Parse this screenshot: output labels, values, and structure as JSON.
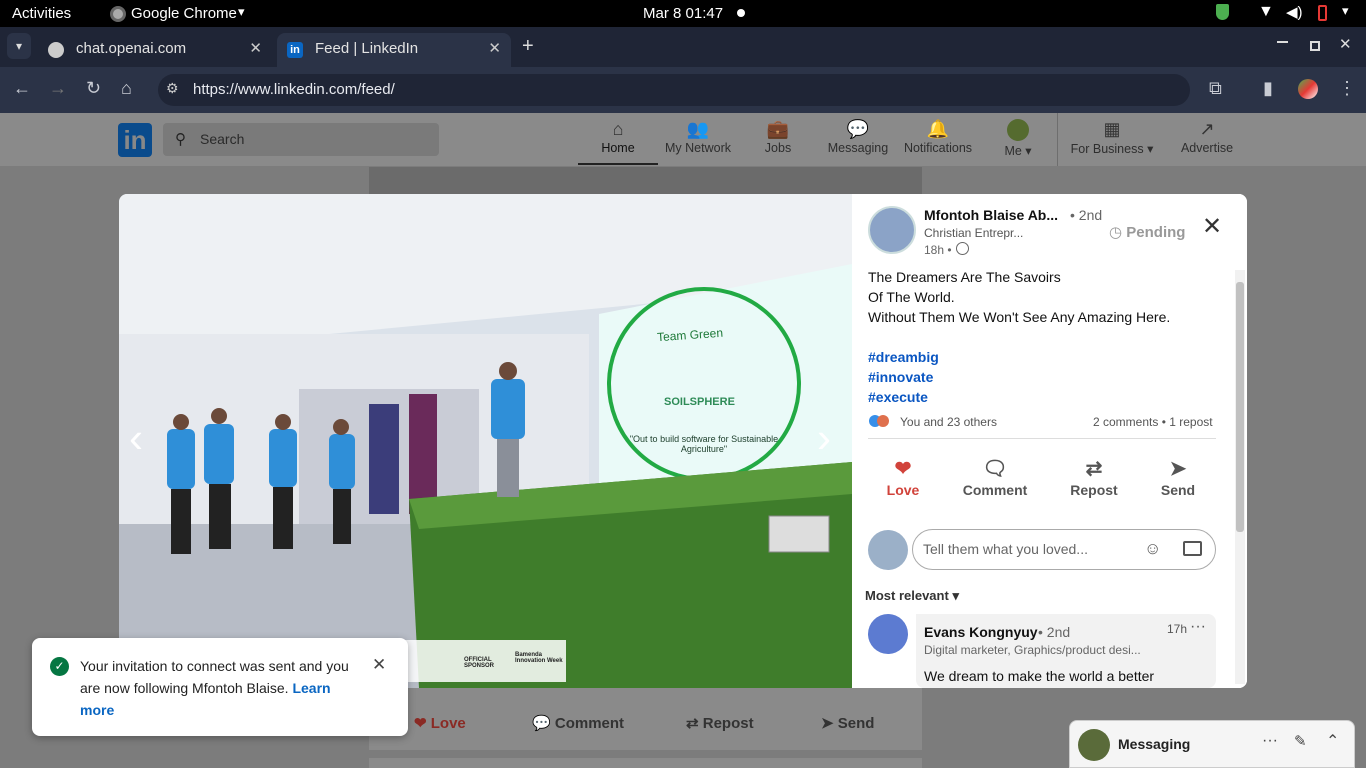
{
  "topbar": {
    "activities": "Activities",
    "app": "Google Chrome",
    "datetime": "Mar 8  01:47"
  },
  "tabs": [
    {
      "title": "chat.openai.com"
    },
    {
      "title": "Feed | LinkedIn"
    }
  ],
  "toolbar": {
    "url": "https://www.linkedin.com/feed/"
  },
  "linkedin": {
    "logo": "in",
    "search_placeholder": "Search",
    "nav": [
      {
        "label": "Home",
        "icon": "home-icon"
      },
      {
        "label": "My Network",
        "icon": "network-icon"
      },
      {
        "label": "Jobs",
        "icon": "jobs-icon"
      },
      {
        "label": "Messaging",
        "icon": "messaging-icon"
      },
      {
        "label": "Notifications",
        "icon": "bell-icon"
      },
      {
        "label": "Me",
        "icon": "avatar"
      },
      {
        "label": "For Business",
        "icon": "grid-icon"
      },
      {
        "label": "Advertise",
        "icon": "advertise-icon"
      }
    ]
  },
  "photo": {
    "screen_title": "Team Green",
    "screen_brand": "SOILSPHERE",
    "screen_tagline": "\"Out to build software for Sustainable Agriculture\"",
    "banner_1": "OFFICIAL SPONSOR",
    "banner_2": "Bamenda Innovation Week"
  },
  "post": {
    "author": "Mfontoh Blaise Ab...",
    "degree": "• 2nd",
    "headline": "Christian Entrepr...",
    "time": "18h •",
    "status": "Pending",
    "text_lines": [
      "The Dreamers Are The Savoirs",
      "Of The World.",
      "Without Them We Won't See Any Amazing Here."
    ],
    "hashtags": [
      "#dreambig",
      "#innovate",
      "#execute"
    ],
    "reactions": "You and 23 others",
    "counts": "2 comments • 1 repost",
    "actions": [
      "Love",
      "Comment",
      "Repost",
      "Send"
    ],
    "comment_placeholder": "Tell them what you loved...",
    "sort": "Most relevant",
    "comment": {
      "name": "Evans Kongnyuy",
      "degree": "• 2nd",
      "headline": "Digital marketer, Graphics/product desi...",
      "time": "17h",
      "text": "We dream to make the world a better"
    }
  },
  "feed_actions": [
    "Love",
    "Comment",
    "Repost",
    "Send"
  ],
  "toast": {
    "text": "Your invitation to connect was sent and you are now following Mfontoh Blaise.",
    "link": "Learn more"
  },
  "messaging": {
    "label": "Messaging"
  },
  "colors": {
    "linkedin_blue": "#0a66c2",
    "love_red": "#d1433b",
    "hashtag": "#0a56c2",
    "success_green": "#057642"
  }
}
